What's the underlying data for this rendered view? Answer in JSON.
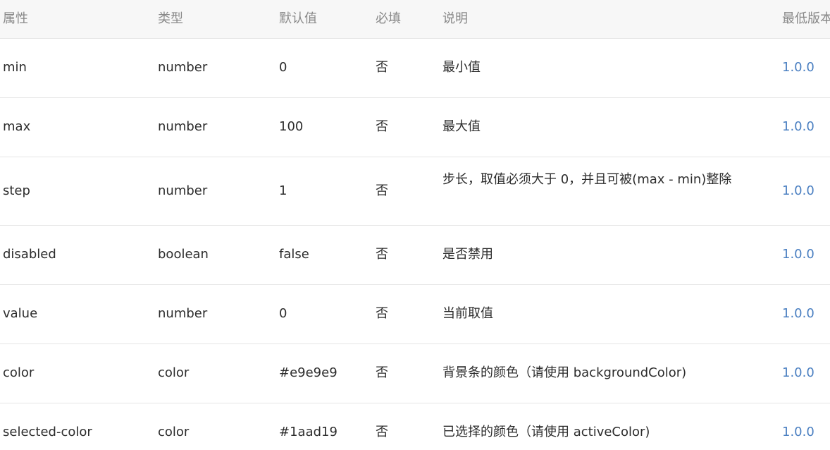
{
  "headers": {
    "prop": "属性",
    "type": "类型",
    "default": "默认值",
    "required": "必填",
    "desc": "说明",
    "version": "最低版本"
  },
  "rows": [
    {
      "prop": "min",
      "type": "number",
      "default": "0",
      "required": "否",
      "desc": "最小值",
      "version": "1.0.0"
    },
    {
      "prop": "max",
      "type": "number",
      "default": "100",
      "required": "否",
      "desc": "最大值",
      "version": "1.0.0"
    },
    {
      "prop": "step",
      "type": "number",
      "default": "1",
      "required": "否",
      "desc": "步长，取值必须大于 0，并且可被(max - min)整除",
      "version": "1.0.0"
    },
    {
      "prop": "disabled",
      "type": "boolean",
      "default": "false",
      "required": "否",
      "desc": "是否禁用",
      "version": "1.0.0"
    },
    {
      "prop": "value",
      "type": "number",
      "default": "0",
      "required": "否",
      "desc": "当前取值",
      "version": "1.0.0"
    },
    {
      "prop": "color",
      "type": "color",
      "default": "#e9e9e9",
      "required": "否",
      "desc": "背景条的颜色（请使用 backgroundColor)",
      "version": "1.0.0"
    },
    {
      "prop": "selected-color",
      "type": "color",
      "default": "#1aad19",
      "required": "否",
      "desc": "已选择的颜色（请使用 activeColor)",
      "version": "1.0.0"
    }
  ],
  "colors": {
    "header_bg": "#f7f7f7",
    "header_text": "#888888",
    "body_text": "#2c2c2c",
    "link": "#4a7fc1",
    "border": "#e6e6e6"
  }
}
